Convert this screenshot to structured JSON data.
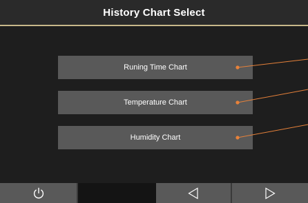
{
  "header": {
    "title": "History Chart Select"
  },
  "menu": {
    "items": [
      {
        "label": "Runing Time Chart"
      },
      {
        "label": "Temperature Chart"
      },
      {
        "label": "Humidity Chart"
      }
    ]
  },
  "footer": {
    "buttons": [
      {
        "icon": "power-icon"
      },
      {
        "icon": "blank"
      },
      {
        "icon": "triangle-left-icon"
      },
      {
        "icon": "triangle-right-icon"
      }
    ]
  },
  "colors": {
    "background": "#1e1e1e",
    "header_bg": "#2a2a2a",
    "header_rule": "#c8b88a",
    "button_bg": "#595959",
    "callout": "#e8823a"
  }
}
